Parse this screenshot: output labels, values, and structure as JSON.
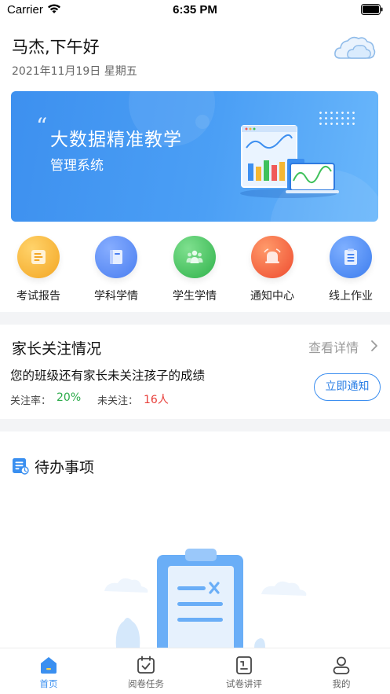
{
  "status_bar": {
    "carrier": "Carrier",
    "time": "6:35 PM"
  },
  "header": {
    "greeting": "马杰,下午好",
    "date": "2021年11月19日 星期五"
  },
  "banner": {
    "quote": "“",
    "title": "大数据精准教学",
    "subtitle": "管理系统"
  },
  "quick_actions": [
    {
      "label": "考试报告",
      "icon": "exam-report-icon",
      "color": "#f5b733"
    },
    {
      "label": "学科学情",
      "icon": "subject-book-icon",
      "color": "#5a8cf1"
    },
    {
      "label": "学生学情",
      "icon": "students-group-icon",
      "color": "#3fc15b"
    },
    {
      "label": "通知中心",
      "icon": "notification-bell-icon",
      "color": "#f0583a"
    },
    {
      "label": "线上作业",
      "icon": "online-homework-icon",
      "color": "#3d7ff0"
    }
  ],
  "parent_section": {
    "title": "家长关注情况",
    "link": "查看详情",
    "message": "您的班级还有家长未关注孩子的成绩",
    "rate_label": "关注率：",
    "rate_value": "20%",
    "unfollow_label": "未关注：",
    "unfollow_value": "16人",
    "notify_button": "立即通知"
  },
  "todo_section": {
    "title": "待办事项"
  },
  "tab_bar": {
    "tabs": [
      {
        "label": "首页",
        "icon": "home-icon",
        "active": true
      },
      {
        "label": "阅卷任务",
        "icon": "calendar-check-icon",
        "active": false
      },
      {
        "label": "试卷讲评",
        "icon": "paper-review-icon",
        "active": false
      },
      {
        "label": "我的",
        "icon": "user-profile-icon",
        "active": false
      }
    ]
  },
  "colors": {
    "accent": "#3a8ff0",
    "green": "#2cab4a",
    "red": "#e8403b"
  }
}
